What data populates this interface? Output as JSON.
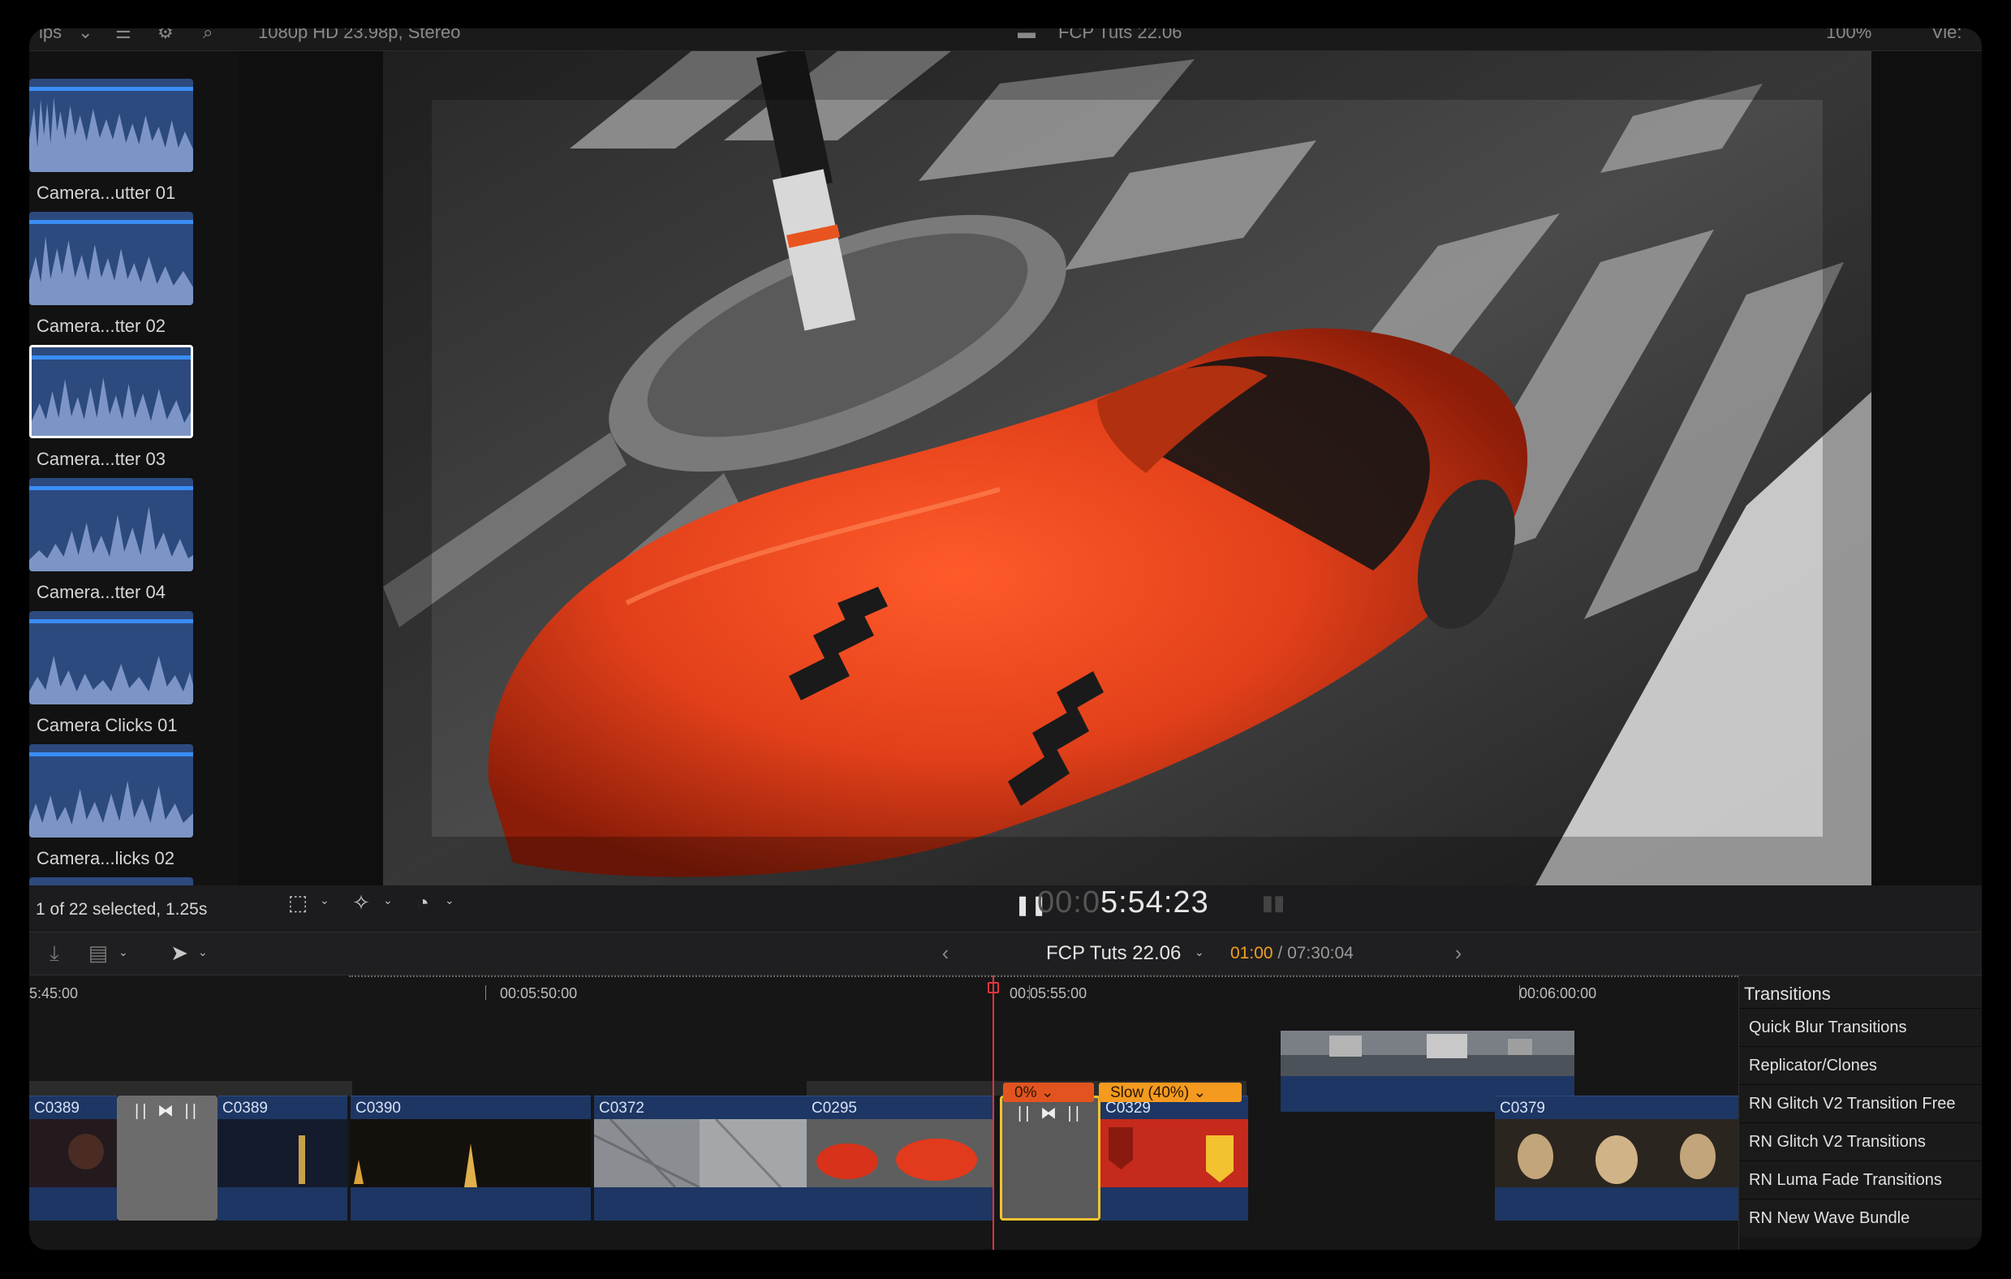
{
  "topbar": {
    "left_menu": "ips",
    "format": "1080p HD 23.98p, Stereo",
    "project": "FCP Tuts 22.06",
    "zoom": "100%",
    "view": "Vie:"
  },
  "browser": {
    "clips": [
      {
        "label": "Camera...utter 01"
      },
      {
        "label": "Camera...tter 02"
      },
      {
        "label": "Camera...tter 03",
        "selected": true
      },
      {
        "label": "Camera...tter 04"
      },
      {
        "label": "Camera Clicks 01"
      },
      {
        "label": "Camera...licks 02"
      }
    ],
    "selection_status": "1 of 22 selected, 1.25s"
  },
  "viewer": {
    "timecode_dim": "00:0",
    "timecode": "5:54:23",
    "play_icon": "pause-icon"
  },
  "timeline_toolbar": {
    "project_name": "FCP Tuts 22.06",
    "current": "01:00",
    "separator": " / ",
    "total": "07:30:04"
  },
  "ruler": {
    "labels": [
      "5:45:00",
      "00:05:50:00",
      "00:05:55:00",
      "00:06:00:00"
    ]
  },
  "timeline": {
    "clips": [
      "C0389",
      "C0389",
      "C0390",
      "C0372",
      "C0295",
      "C0329",
      "C0379"
    ],
    "retime": [
      "0%",
      "Slow (40%)"
    ]
  },
  "transitions_panel": {
    "title": "Transitions",
    "items": [
      "Quick Blur Transitions",
      "Replicator/Clones",
      "RN Glitch V2 Transition Free",
      "RN Glitch V2 Transitions",
      "RN Luma Fade Transitions",
      "RN New Wave Bundle"
    ]
  },
  "colors": {
    "accent_blue": "#3a8df5",
    "clip_blue": "#1d3663",
    "playhead": "#e0343b",
    "retime_orange": "#f39a1f",
    "retime_red": "#e2541f",
    "selection_yellow": "#f2c230"
  }
}
